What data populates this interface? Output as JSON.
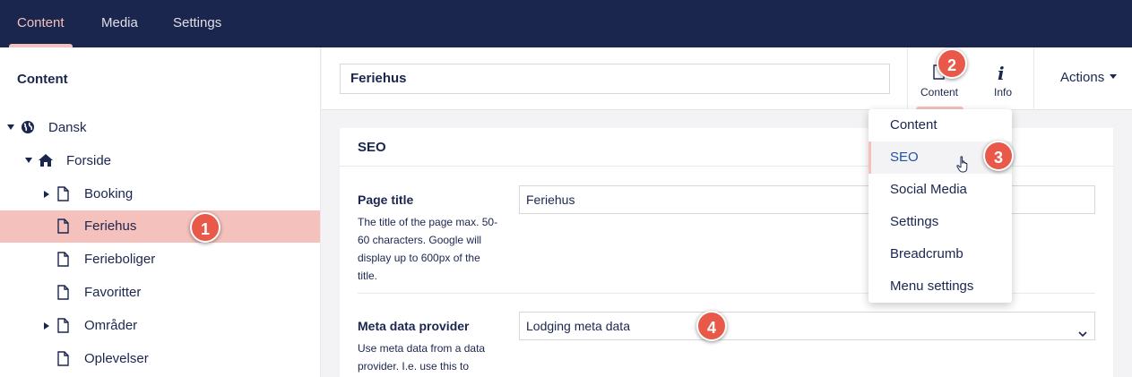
{
  "topnav": {
    "tabs": [
      {
        "label": "Content",
        "active": true
      },
      {
        "label": "Media",
        "active": false
      },
      {
        "label": "Settings",
        "active": false
      }
    ]
  },
  "sidebar": {
    "title": "Content",
    "tree": [
      {
        "label": "Dansk",
        "icon": "globe-icon",
        "expanded": true
      },
      {
        "label": "Forside",
        "icon": "home-icon",
        "expanded": true
      },
      {
        "label": "Booking",
        "icon": "document-icon",
        "has_children": true
      },
      {
        "label": "Feriehus",
        "icon": "document-icon",
        "selected": true
      },
      {
        "label": "Ferieboliger",
        "icon": "document-icon"
      },
      {
        "label": "Favoritter",
        "icon": "document-icon"
      },
      {
        "label": "Områder",
        "icon": "document-icon",
        "has_children": true
      },
      {
        "label": "Oplevelser",
        "icon": "document-icon"
      }
    ]
  },
  "editor": {
    "name_value": "Feriehus",
    "apps": [
      {
        "label": "Content",
        "icon": "document-icon"
      },
      {
        "label": "Info",
        "icon": "info-icon"
      }
    ],
    "actions_label": "Actions"
  },
  "panel": {
    "title": "SEO",
    "properties": [
      {
        "label": "Page title",
        "description": "The title of the page max. 50-60 characters. Google will display up to 600px of the title.",
        "value": "Feriehus"
      },
      {
        "label": "Meta data provider",
        "description": "Use meta data from a data provider. I.e. use this to",
        "value": "Lodging meta data"
      }
    ]
  },
  "dropdown": {
    "items": [
      {
        "label": "Content"
      },
      {
        "label": "SEO",
        "active": true
      },
      {
        "label": "Social Media"
      },
      {
        "label": "Settings"
      },
      {
        "label": "Breadcrumb"
      },
      {
        "label": "Menu settings"
      }
    ]
  },
  "badges": [
    "1",
    "2",
    "3",
    "4"
  ],
  "colors": {
    "topbar": "#1b264f",
    "accent": "#f5c1bc",
    "badge": "#e8594a",
    "text": "#1b264f",
    "active_link": "#2152a3"
  }
}
